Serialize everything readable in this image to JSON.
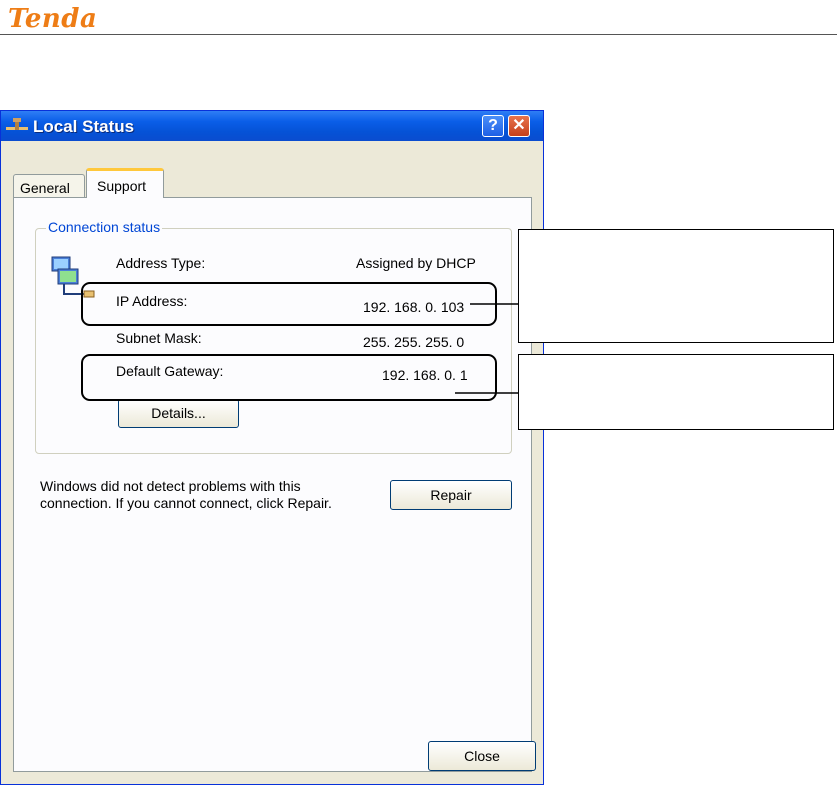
{
  "brand": {
    "logo": "Tenda",
    "accent": "#ee7d16"
  },
  "window": {
    "title": "Local Status",
    "title_icon": "network-connection-icon",
    "help_glyph": "?",
    "close_glyph": "✕"
  },
  "tabs": [
    {
      "label": "General",
      "selected": false
    },
    {
      "label": "Support",
      "selected": true
    }
  ],
  "connection_status": {
    "group_label": "Connection status",
    "icon": "network-computers-icon",
    "rows": [
      {
        "label": "Address Type:",
        "value": "Assigned by DHCP"
      },
      {
        "label": "IP Address:",
        "value": "192. 168. 0. 103"
      },
      {
        "label": "Subnet Mask:",
        "value": "255. 255. 255. 0"
      },
      {
        "label": "Default Gateway:",
        "value": "192. 168. 0. 1"
      }
    ],
    "details_button": "Details..."
  },
  "repair_note": "Windows did not detect problems with this connection. If you cannot connect, click Repair.",
  "repair_button": "Repair",
  "close_button": "Close",
  "colors": {
    "titlebar": "#0a5ee8",
    "group_label": "#0046d5",
    "tab_highlight": "#ffc83c"
  }
}
